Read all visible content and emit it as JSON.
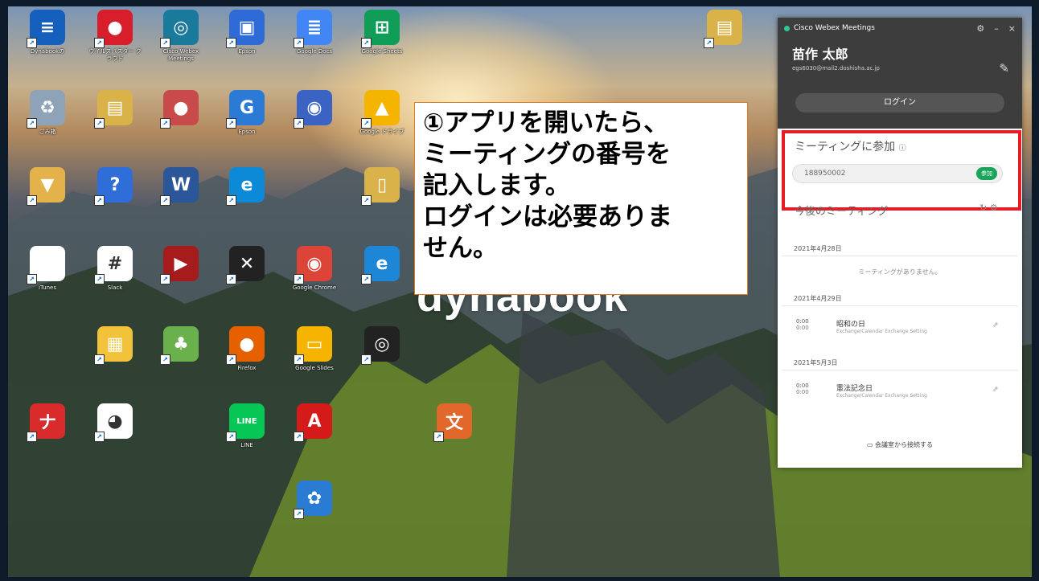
{
  "desktop": {
    "icons": [
      {
        "label": "Dynabookの",
        "name": "dynabook-app-icon",
        "glyph": "≡",
        "color": "#1560bd"
      },
      {
        "label": "ウイルスバスター クラウド",
        "name": "virus-buster-icon",
        "glyph": "●",
        "color": "#d81e2a"
      },
      {
        "label": "Cisco Webex Meetings",
        "name": "webex-meetings-icon",
        "glyph": "◎",
        "color": "#1a7a9c"
      },
      {
        "label": "Epson",
        "name": "epson-icon",
        "glyph": "▣",
        "color": "#2e6bd6"
      },
      {
        "label": "Google Docs",
        "name": "google-docs-icon",
        "glyph": "≣",
        "color": "#4285f4"
      },
      {
        "label": "Google Sheets",
        "name": "google-sheets-icon",
        "glyph": "⊞",
        "color": "#0f9d58"
      },
      {
        "label": "ごみ箱",
        "name": "recycle-bin-icon",
        "glyph": "♻",
        "color": "#8fa3b8"
      },
      {
        "label": "",
        "name": "folder-icon",
        "glyph": "▤",
        "color": "#d9b24a"
      },
      {
        "label": "",
        "name": "app-shortcut-icon",
        "glyph": "●",
        "color": "#c84a4a"
      },
      {
        "label": "Epson",
        "name": "epson-app-icon",
        "glyph": "G",
        "color": "#2b7bd6"
      },
      {
        "label": "",
        "name": "game-controller-icon",
        "glyph": "◉",
        "color": "#3b63c4"
      },
      {
        "label": "Google ドライブ",
        "name": "google-drive-icon",
        "glyph": "▲",
        "color": "#f4b400"
      },
      {
        "label": "",
        "name": "download-folder-icon",
        "glyph": "▼",
        "color": "#e4b24a"
      },
      {
        "label": "",
        "name": "help-icon",
        "glyph": "?",
        "color": "#2f6ed8"
      },
      {
        "label": "",
        "name": "word-icon",
        "glyph": "W",
        "color": "#2b579a"
      },
      {
        "label": "",
        "name": "edge-icon",
        "glyph": "e",
        "color": "#0c8ad8"
      },
      {
        "label": "",
        "name": "document-icon",
        "glyph": "▯",
        "color": "#d9b24a"
      },
      {
        "label": "iTunes",
        "name": "itunes-icon",
        "glyph": "",
        "color": "#ffffff"
      },
      {
        "label": "Slack",
        "name": "slack-icon",
        "glyph": "#",
        "color": "#ffffff"
      },
      {
        "label": "",
        "name": "toshiba-video-icon",
        "glyph": "▶",
        "color": "#a61c1c"
      },
      {
        "label": "",
        "name": "studio-one-icon",
        "glyph": "✕",
        "color": "#222222"
      },
      {
        "label": "Google Chrome",
        "name": "google-chrome-icon",
        "glyph": "◉",
        "color": "#db4437"
      },
      {
        "label": "",
        "name": "internet-explorer-icon",
        "glyph": "e",
        "color": "#1e86d6"
      },
      {
        "label": "",
        "name": "pdf-folder-icon",
        "glyph": "▦",
        "color": "#f2c23a"
      },
      {
        "label": "",
        "name": "books-app-icon",
        "glyph": "♣",
        "color": "#6ab04c"
      },
      {
        "label": "Firefox",
        "name": "firefox-icon",
        "glyph": "●",
        "color": "#e66000"
      },
      {
        "label": "Google Slides",
        "name": "google-slides-icon",
        "glyph": "▭",
        "color": "#f4b400"
      },
      {
        "label": "",
        "name": "sound-app-icon",
        "glyph": "◎",
        "color": "#222222"
      },
      {
        "label": "",
        "name": "calculator-icon",
        "glyph": "ナ",
        "color": "#d92b2b"
      },
      {
        "label": "",
        "name": "character-icon",
        "glyph": "◕",
        "color": "#ffffff"
      },
      {
        "label": "LINE",
        "name": "line-icon",
        "glyph": "LINE",
        "color": "#06c755"
      },
      {
        "label": "",
        "name": "acrobat-icon",
        "glyph": "A",
        "color": "#d51a1a"
      },
      {
        "label": "",
        "name": "stationery-icon",
        "glyph": "文",
        "color": "#e2672a"
      },
      {
        "label": "",
        "name": "cleaner-icon",
        "glyph": "✿",
        "color": "#2a7bd4"
      },
      {
        "label": "",
        "name": "folder-shortcut-icon",
        "glyph": "▤",
        "color": "#d9b24a"
      }
    ],
    "brand": "dynabook"
  },
  "callout": {
    "lines": [
      "①アプリを開いたら、",
      "ミーティングの番号を",
      "記入します。",
      "ログインは必要ありま",
      "せん。"
    ]
  },
  "webex": {
    "title": "Cisco Webex Meetings",
    "user_name": "苗作 太郎",
    "user_email": "egs6030@mail2.doshisha.ac.jp",
    "login_label": "ログイン",
    "join_heading": "ミーティングに参加",
    "meeting_number": "188950002",
    "join_button": "参加",
    "upcoming_heading": "今後のミーティング",
    "dates": [
      {
        "date": "2021年4月28日",
        "no_meetings": "ミーティングがありません。"
      },
      {
        "date": "2021年4月29日",
        "meeting": {
          "start": "0:00",
          "end": "0:00",
          "name": "昭和の日",
          "source": "Exchange/Calendar Exchange Setting"
        }
      },
      {
        "date": "2021年5月3日",
        "meeting": {
          "start": "0:00",
          "end": "0:00",
          "name": "憲法記念日",
          "source": "Exchange/Calendar Exchange Setting"
        }
      }
    ],
    "footer": "会議室から接続する"
  }
}
